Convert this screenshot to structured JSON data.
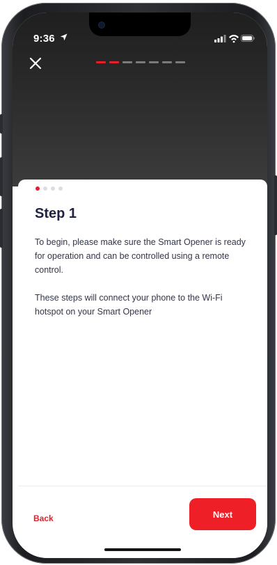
{
  "status_bar": {
    "time": "9:36",
    "icons": [
      "location-arrow-icon",
      "cellular-signal-icon",
      "wifi-icon",
      "battery-icon"
    ]
  },
  "header": {
    "close_icon": "close-icon",
    "progress": {
      "total_steps": 7,
      "current_step": 2
    }
  },
  "card": {
    "page_indicator": {
      "total": 4,
      "current": 1
    },
    "title": "Step 1",
    "paragraph_1": "To begin, please make sure the Smart Opener is ready for operation and can be controlled using a remote control.",
    "paragraph_2": "These steps will connect your phone to the Wi-Fi hotspot on your Smart Opener"
  },
  "footer": {
    "back_label": "Back",
    "next_label": "Next"
  },
  "colors": {
    "accent": "#ee1f27",
    "title": "#1e2240",
    "body_text": "#33364a",
    "header_bg": "#2b2b2b"
  }
}
